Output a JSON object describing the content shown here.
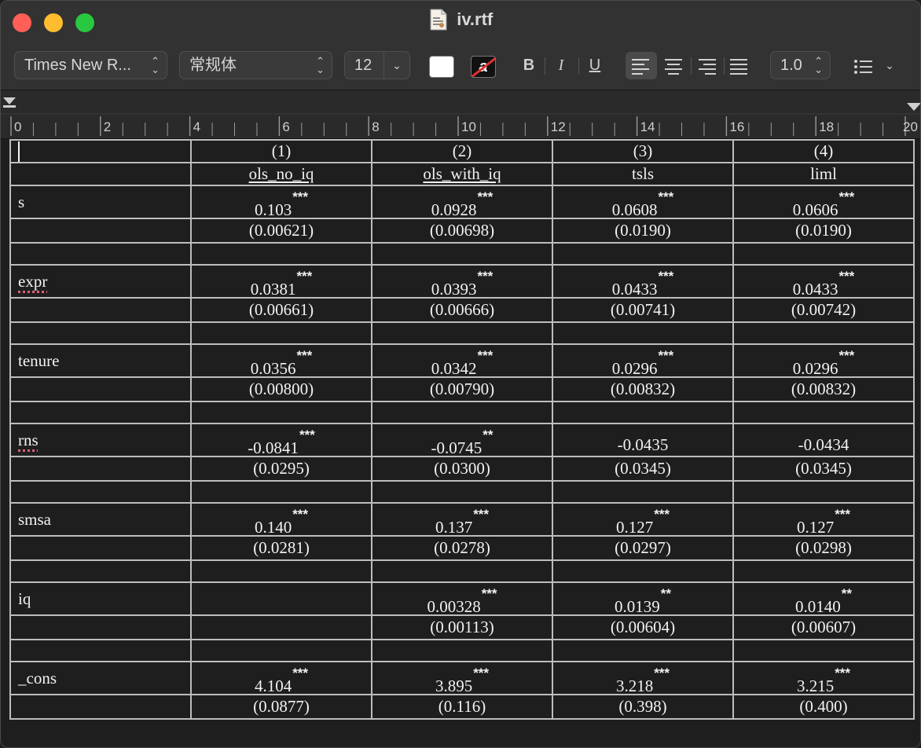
{
  "window": {
    "title": "iv.rtf"
  },
  "toolbar": {
    "font_family": "Times New R...",
    "font_style": "常规体",
    "font_size": "12",
    "bold": "B",
    "italic": "I",
    "underline": "U",
    "line_spacing": "1.0",
    "text_color": "#ffffff",
    "highlight_color": "#e03030",
    "highlight_glyph": "a"
  },
  "ruler": {
    "labels": [
      "0",
      "2",
      "4",
      "6",
      "8",
      "10",
      "12",
      "14",
      "16",
      "18",
      "20"
    ]
  },
  "table": {
    "header_numbers": [
      "(1)",
      "(2)",
      "(3)",
      "(4)"
    ],
    "header_names": [
      "ols_no_iq",
      "ols_with_iq",
      "tsls",
      "liml"
    ],
    "rows": [
      {
        "var": "s",
        "coef": [
          [
            "0.103",
            "***"
          ],
          [
            "0.0928",
            "***"
          ],
          [
            "0.0608",
            "***"
          ],
          [
            "0.0606",
            "***"
          ]
        ],
        "se": [
          "(0.00621)",
          "(0.00698)",
          "(0.0190)",
          "(0.0190)"
        ]
      },
      {
        "var": "expr",
        "coef": [
          [
            "0.0381",
            "***"
          ],
          [
            "0.0393",
            "***"
          ],
          [
            "0.0433",
            "***"
          ],
          [
            "0.0433",
            "***"
          ]
        ],
        "se": [
          "(0.00661)",
          "(0.00666)",
          "(0.00741)",
          "(0.00742)"
        ]
      },
      {
        "var": "tenure",
        "coef": [
          [
            "0.0356",
            "***"
          ],
          [
            "0.0342",
            "***"
          ],
          [
            "0.0296",
            "***"
          ],
          [
            "0.0296",
            "***"
          ]
        ],
        "se": [
          "(0.00800)",
          "(0.00790)",
          "(0.00832)",
          "(0.00832)"
        ]
      },
      {
        "var": "rns",
        "coef": [
          [
            "-0.0841",
            "***"
          ],
          [
            "-0.0745",
            "**"
          ],
          [
            "-0.0435",
            ""
          ],
          [
            "-0.0434",
            ""
          ]
        ],
        "se": [
          "(0.0295)",
          "(0.0300)",
          "(0.0345)",
          "(0.0345)"
        ]
      },
      {
        "var": "smsa",
        "coef": [
          [
            "0.140",
            "***"
          ],
          [
            "0.137",
            "***"
          ],
          [
            "0.127",
            "***"
          ],
          [
            "0.127",
            "***"
          ]
        ],
        "se": [
          "(0.0281)",
          "(0.0278)",
          "(0.0297)",
          "(0.0298)"
        ]
      },
      {
        "var": "iq",
        "coef": [
          [
            "",
            ""
          ],
          [
            "0.00328",
            "***"
          ],
          [
            "0.0139",
            "**"
          ],
          [
            "0.0140",
            "**"
          ]
        ],
        "se": [
          "",
          "(0.00113)",
          "(0.00604)",
          "(0.00607)"
        ]
      },
      {
        "var": "_cons",
        "coef": [
          [
            "4.104",
            "***"
          ],
          [
            "3.895",
            "***"
          ],
          [
            "3.218",
            "***"
          ],
          [
            "3.215",
            "***"
          ]
        ],
        "se": [
          "(0.0877)",
          "(0.116)",
          "(0.398)",
          "(0.400)"
        ]
      }
    ]
  }
}
